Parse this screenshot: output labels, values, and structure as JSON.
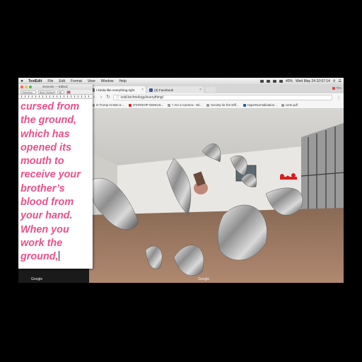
{
  "menubar": {
    "app_name": "TextEdit",
    "items": [
      "File",
      "Edit",
      "Format",
      "View",
      "Window",
      "Help"
    ],
    "status": {
      "battery": "40%",
      "clock": "Wed May 24  10:57:14"
    }
  },
  "textedit": {
    "document_title": "Genesis — Edited",
    "font_family": "Helvetica",
    "font_style": "Bold Oblique",
    "font_size": "48",
    "body_lines": [
      "cursed from",
      "the ground,",
      "which has",
      "opened its",
      "mouth to",
      "receive your",
      "brother’s",
      "blood from",
      "your hand.",
      "When you",
      "work the",
      "ground,"
    ],
    "text_color": "#e8508a"
  },
  "browser": {
    "tabs": [
      {
        "label": "I kinda like everything.right",
        "icon": "page-icon"
      },
      {
        "label": "(3) Facebook",
        "icon": "facebook-icon"
      }
    ],
    "user": "Tim",
    "url": "void.technology/everything/",
    "bookmarks": [
      "Is Trump At Mar-a-...",
      "STARSHIP GENIUS...",
      "'I Am a Camera - Wi...",
      "Society for the Diff...",
      "HyperNormalisation...",
      "certe.pdf"
    ]
  },
  "dock": {
    "label_left": "Google",
    "label_right": "Google"
  }
}
